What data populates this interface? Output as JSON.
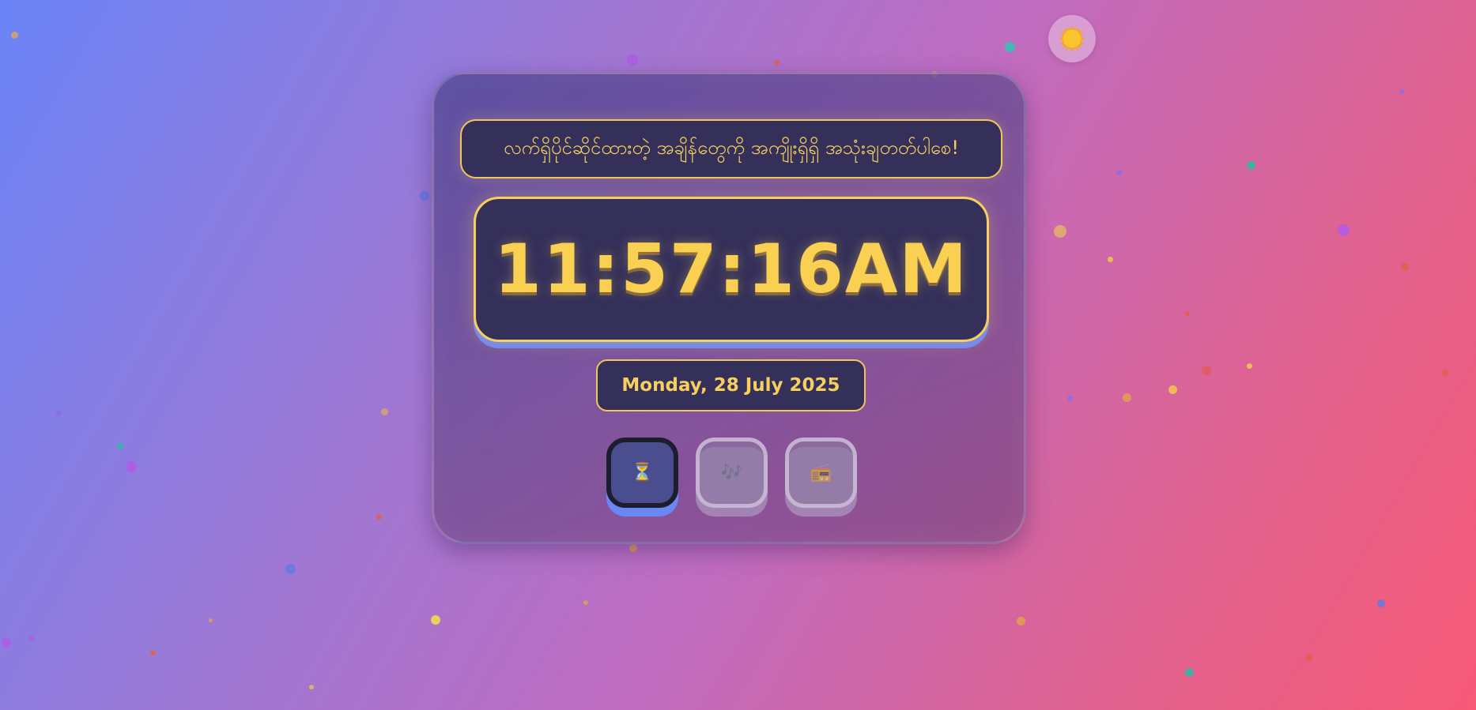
{
  "theme_toggle": {
    "icon": "sun-icon",
    "colors": {
      "core": "#f9c52e",
      "rays": "#f6a623"
    }
  },
  "banner": {
    "text": "လက်ရှိပိုင်ဆိုင်ထားတဲ့ အချိန်တွေကို အကျိုးရှိရှိ အသုံးချတတ်ပါစေ!"
  },
  "clock": {
    "time": "11:57:16AM"
  },
  "date": {
    "text": "Monday, 28 July 2025"
  },
  "modes": [
    {
      "icon": "hourglass-icon",
      "glyph": "⏳",
      "active": true
    },
    {
      "icon": "music-notes-icon",
      "glyph": "🎶",
      "active": false
    },
    {
      "icon": "radio-icon",
      "glyph": "📻",
      "active": false
    }
  ],
  "colors": {
    "accent_gold": "#f6cf5c",
    "panel_dark": "#34305a",
    "accent_blue": "#6b86f5"
  }
}
